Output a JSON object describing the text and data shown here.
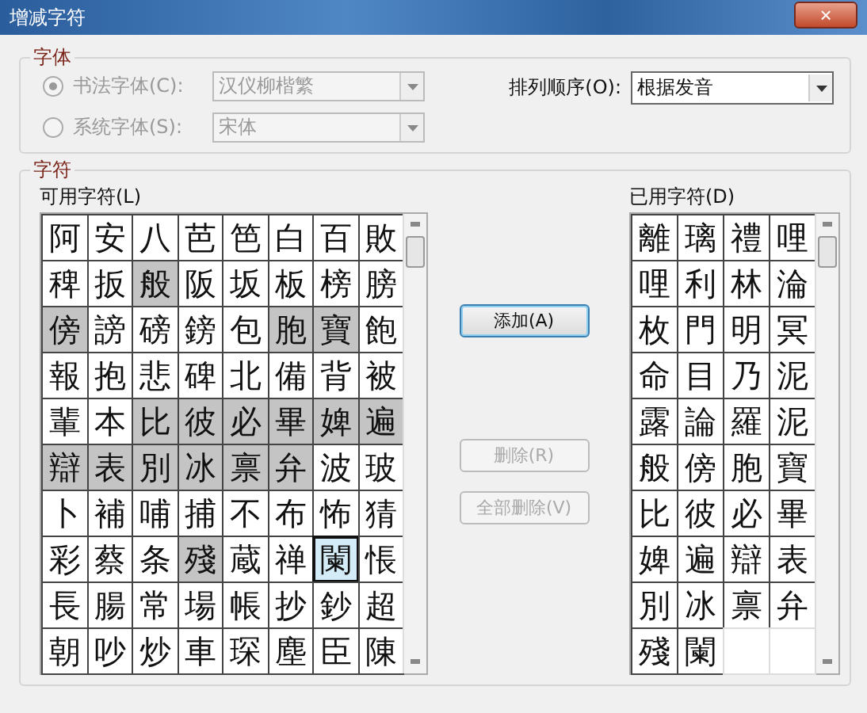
{
  "window": {
    "title": "增减字符",
    "close": "×"
  },
  "font_group": {
    "title": "字体",
    "options": [
      {
        "label": "书法字体(C):",
        "selected": true,
        "disabled": true,
        "value": "汉仪柳楷繁"
      },
      {
        "label": "系统字体(S):",
        "selected": false,
        "disabled": true,
        "value": "宋体"
      }
    ],
    "sort": {
      "label": "排列顺序(O):",
      "value": "根据发音"
    }
  },
  "char_group": {
    "title": "字符",
    "available": {
      "label": "可用字符(L)",
      "cells": [
        {
          "char": "阿",
          "selected": false,
          "focused": false
        },
        {
          "char": "安",
          "selected": false,
          "focused": false
        },
        {
          "char": "八",
          "selected": false,
          "focused": false
        },
        {
          "char": "芭",
          "selected": false,
          "focused": false
        },
        {
          "char": "笆",
          "selected": false,
          "focused": false
        },
        {
          "char": "白",
          "selected": false,
          "focused": false
        },
        {
          "char": "百",
          "selected": false,
          "focused": false
        },
        {
          "char": "敗",
          "selected": false,
          "focused": false
        },
        {
          "char": "稗",
          "selected": false,
          "focused": false
        },
        {
          "char": "扳",
          "selected": false,
          "focused": false
        },
        {
          "char": "般",
          "selected": true,
          "focused": false
        },
        {
          "char": "阪",
          "selected": false,
          "focused": false
        },
        {
          "char": "坂",
          "selected": false,
          "focused": false
        },
        {
          "char": "板",
          "selected": false,
          "focused": false
        },
        {
          "char": "榜",
          "selected": false,
          "focused": false
        },
        {
          "char": "膀",
          "selected": false,
          "focused": false
        },
        {
          "char": "傍",
          "selected": true,
          "focused": false
        },
        {
          "char": "謗",
          "selected": false,
          "focused": false
        },
        {
          "char": "磅",
          "selected": false,
          "focused": false
        },
        {
          "char": "鎊",
          "selected": false,
          "focused": false
        },
        {
          "char": "包",
          "selected": false,
          "focused": false
        },
        {
          "char": "胞",
          "selected": true,
          "focused": false
        },
        {
          "char": "寶",
          "selected": true,
          "focused": false
        },
        {
          "char": "飽",
          "selected": false,
          "focused": false
        },
        {
          "char": "報",
          "selected": false,
          "focused": false
        },
        {
          "char": "抱",
          "selected": false,
          "focused": false
        },
        {
          "char": "悲",
          "selected": false,
          "focused": false
        },
        {
          "char": "碑",
          "selected": false,
          "focused": false
        },
        {
          "char": "北",
          "selected": false,
          "focused": false
        },
        {
          "char": "備",
          "selected": false,
          "focused": false
        },
        {
          "char": "背",
          "selected": false,
          "focused": false
        },
        {
          "char": "被",
          "selected": false,
          "focused": false
        },
        {
          "char": "輩",
          "selected": false,
          "focused": false
        },
        {
          "char": "本",
          "selected": false,
          "focused": false
        },
        {
          "char": "比",
          "selected": true,
          "focused": false
        },
        {
          "char": "彼",
          "selected": true,
          "focused": false
        },
        {
          "char": "必",
          "selected": true,
          "focused": false
        },
        {
          "char": "畢",
          "selected": true,
          "focused": false
        },
        {
          "char": "婢",
          "selected": true,
          "focused": false
        },
        {
          "char": "遍",
          "selected": true,
          "focused": false
        },
        {
          "char": "辯",
          "selected": true,
          "focused": false
        },
        {
          "char": "表",
          "selected": true,
          "focused": false
        },
        {
          "char": "別",
          "selected": true,
          "focused": false
        },
        {
          "char": "冰",
          "selected": true,
          "focused": false
        },
        {
          "char": "禀",
          "selected": true,
          "focused": false
        },
        {
          "char": "弁",
          "selected": true,
          "focused": false
        },
        {
          "char": "波",
          "selected": false,
          "focused": false
        },
        {
          "char": "玻",
          "selected": false,
          "focused": false
        },
        {
          "char": "卜",
          "selected": false,
          "focused": false
        },
        {
          "char": "補",
          "selected": false,
          "focused": false
        },
        {
          "char": "哺",
          "selected": false,
          "focused": false
        },
        {
          "char": "捕",
          "selected": false,
          "focused": false
        },
        {
          "char": "不",
          "selected": false,
          "focused": false
        },
        {
          "char": "布",
          "selected": false,
          "focused": false
        },
        {
          "char": "怖",
          "selected": false,
          "focused": false
        },
        {
          "char": "猜",
          "selected": false,
          "focused": false
        },
        {
          "char": "彩",
          "selected": false,
          "focused": false
        },
        {
          "char": "蔡",
          "selected": false,
          "focused": false
        },
        {
          "char": "条",
          "selected": false,
          "focused": false
        },
        {
          "char": "殘",
          "selected": true,
          "focused": false
        },
        {
          "char": "蔵",
          "selected": false,
          "focused": false
        },
        {
          "char": "禅",
          "selected": false,
          "focused": false
        },
        {
          "char": "闌",
          "selected": false,
          "focused": true
        },
        {
          "char": "悵",
          "selected": false,
          "focused": false
        },
        {
          "char": "長",
          "selected": false,
          "focused": false
        },
        {
          "char": "腸",
          "selected": false,
          "focused": false
        },
        {
          "char": "常",
          "selected": false,
          "focused": false
        },
        {
          "char": "場",
          "selected": false,
          "focused": false
        },
        {
          "char": "帳",
          "selected": false,
          "focused": false
        },
        {
          "char": "抄",
          "selected": false,
          "focused": false
        },
        {
          "char": "鈔",
          "selected": false,
          "focused": false
        },
        {
          "char": "超",
          "selected": false,
          "focused": false
        },
        {
          "char": "朝",
          "selected": false,
          "focused": false
        },
        {
          "char": "吵",
          "selected": false,
          "focused": false
        },
        {
          "char": "炒",
          "selected": false,
          "focused": false
        },
        {
          "char": "車",
          "selected": false,
          "focused": false
        },
        {
          "char": "琛",
          "selected": false,
          "focused": false
        },
        {
          "char": "塵",
          "selected": false,
          "focused": false
        },
        {
          "char": "臣",
          "selected": false,
          "focused": false
        },
        {
          "char": "陳",
          "selected": false,
          "focused": false
        }
      ]
    },
    "buttons": [
      {
        "label": "添加(A)",
        "disabled": false
      },
      {
        "label": "删除(R)",
        "disabled": true
      },
      {
        "label": "全部删除(V)",
        "disabled": true
      }
    ],
    "used": {
      "label": "已用字符(D)",
      "cells": [
        "離",
        "璃",
        "禮",
        "哩",
        "哩",
        "利",
        "林",
        "淪",
        "枚",
        "門",
        "明",
        "冥",
        "命",
        "目",
        "乃",
        "泥",
        "露",
        "論",
        "羅",
        "泥",
        "般",
        "傍",
        "胞",
        "寶",
        "比",
        "彼",
        "必",
        "畢",
        "婢",
        "遍",
        "辯",
        "表",
        "別",
        "冰",
        "禀",
        "弁",
        "殘",
        "闌"
      ]
    }
  }
}
